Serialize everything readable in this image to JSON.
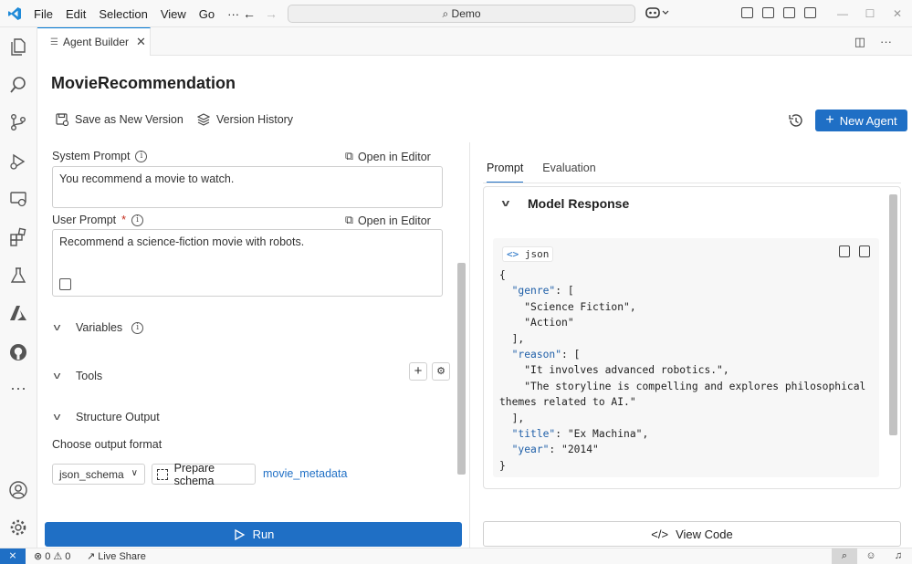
{
  "titlebar": {
    "menu": [
      "File",
      "Edit",
      "Selection",
      "View",
      "Go",
      "···"
    ],
    "search_text": "Demo"
  },
  "tab": {
    "label": "Agent Builder",
    "close": "✕"
  },
  "agent": {
    "name": "MovieRecommendation"
  },
  "toolbar": {
    "save_version": "Save as New Version",
    "version_history": "Version History",
    "new_agent": "New Agent"
  },
  "system_prompt": {
    "label": "System Prompt",
    "open_editor": "Open in Editor",
    "value": "You recommend a movie to watch."
  },
  "user_prompt": {
    "label": "User Prompt",
    "required": "*",
    "open_editor": "Open in Editor",
    "value": "Recommend a science-fiction movie with robots."
  },
  "sections": {
    "variables": "Variables",
    "tools": "Tools",
    "structure_output": "Structure Output"
  },
  "output": {
    "choose_label": "Choose output format",
    "format_value": "json_schema",
    "prepare_schema": "Prepare schema",
    "schema_name": "movie_metadata"
  },
  "run": {
    "label": "Run"
  },
  "right_tabs": [
    "Prompt",
    "Evaluation"
  ],
  "response": {
    "heading": "Model Response",
    "lang": "json",
    "code": {
      "genre_key": "\"genre\"",
      "genre": [
        "\"Science Fiction\"",
        "\"Action\""
      ],
      "reason_key": "\"reason\"",
      "reason_1": "\"It involves advanced robotics.\",",
      "reason_2a": "\"The storyline is compelling and explores philosophical",
      "reason_2b": "themes related to AI.\"",
      "title_key": "\"title\"",
      "title": "\"Ex Machina\"",
      "year_key": "\"year\"",
      "year": "\"2014\""
    }
  },
  "view_code": {
    "label": "View Code"
  },
  "statusbar": {
    "errors": "0",
    "warnings": "0",
    "live_share": "Live Share"
  },
  "colors": {
    "accent": "#1f6fc5",
    "link": "#1f6fc5",
    "required": "#c42b1c"
  }
}
